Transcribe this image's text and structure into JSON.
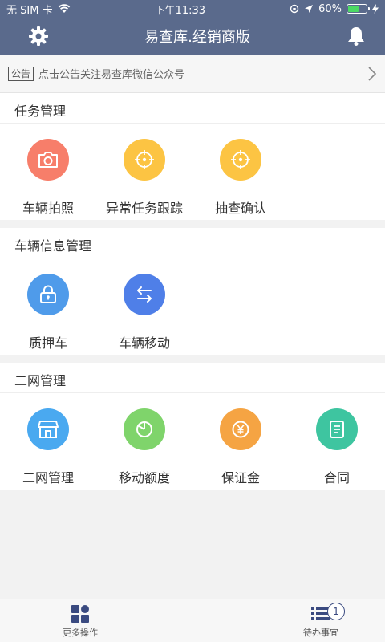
{
  "status": {
    "carrier": "无 SIM 卡",
    "time": "下午11:33",
    "battery": "60%",
    "battery_level": 0.6
  },
  "header": {
    "title": "易查库.经销商版"
  },
  "notice": {
    "tag": "公告",
    "text": "点击公告关注易查库微信公众号"
  },
  "sections": [
    {
      "title": "任务管理",
      "items": [
        {
          "label": "车辆拍照",
          "color": "#f77e6a"
        },
        {
          "label": "异常任务跟踪",
          "color": "#fcc443"
        },
        {
          "label": "抽查确认",
          "color": "#fcc443"
        }
      ]
    },
    {
      "title": "车辆信息管理",
      "items": [
        {
          "label": "质押车",
          "color": "#4f9bea"
        },
        {
          "label": "车辆移动",
          "color": "#4f7fe8"
        }
      ]
    },
    {
      "title": "二网管理",
      "items": [
        {
          "label": "二网管理",
          "color": "#4aa9f0"
        },
        {
          "label": "移动额度",
          "color": "#7fd46b"
        },
        {
          "label": "保证金",
          "color": "#f5a443"
        },
        {
          "label": "合同",
          "color": "#3ec5a0"
        }
      ]
    }
  ],
  "tabbar": {
    "left_label": "更多操作",
    "right_label": "待办事宜",
    "badge": "1"
  }
}
